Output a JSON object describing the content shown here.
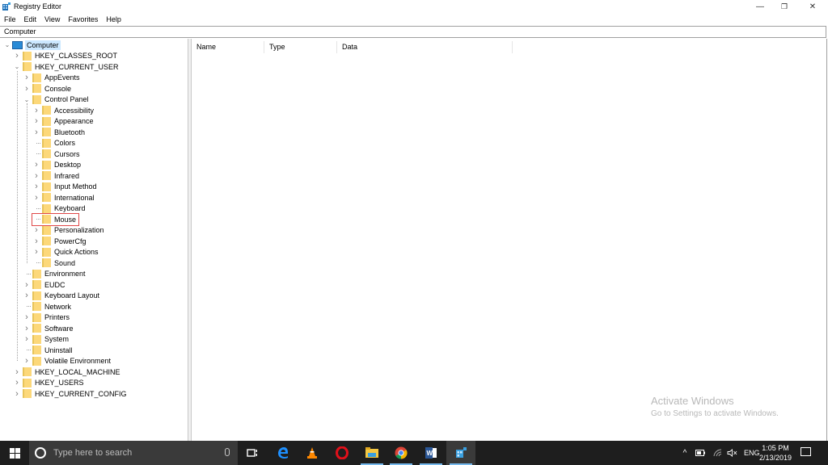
{
  "window": {
    "title": "Registry Editor",
    "controls": {
      "minimize": "—",
      "restore": "❐",
      "close": "✕"
    }
  },
  "menu": [
    "File",
    "Edit",
    "View",
    "Favorites",
    "Help"
  ],
  "address": "Computer",
  "list": {
    "columns": [
      "Name",
      "Type",
      "Data"
    ],
    "rows": []
  },
  "tree": {
    "root": "Computer",
    "nodes": [
      {
        "label": "HKEY_CLASSES_ROOT",
        "level": 1,
        "expander": "collapsed"
      },
      {
        "label": "HKEY_CURRENT_USER",
        "level": 1,
        "expander": "expanded"
      },
      {
        "label": "AppEvents",
        "level": 2,
        "expander": "collapsed"
      },
      {
        "label": "Console",
        "level": 2,
        "expander": "collapsed"
      },
      {
        "label": "Control Panel",
        "level": 2,
        "expander": "expanded"
      },
      {
        "label": "Accessibility",
        "level": 3,
        "expander": "collapsed"
      },
      {
        "label": "Appearance",
        "level": 3,
        "expander": "collapsed"
      },
      {
        "label": "Bluetooth",
        "level": 3,
        "expander": "collapsed"
      },
      {
        "label": "Colors",
        "level": 3,
        "expander": "none"
      },
      {
        "label": "Cursors",
        "level": 3,
        "expander": "none"
      },
      {
        "label": "Desktop",
        "level": 3,
        "expander": "collapsed"
      },
      {
        "label": "Infrared",
        "level": 3,
        "expander": "collapsed"
      },
      {
        "label": "Input Method",
        "level": 3,
        "expander": "collapsed"
      },
      {
        "label": "International",
        "level": 3,
        "expander": "collapsed"
      },
      {
        "label": "Keyboard",
        "level": 3,
        "expander": "none"
      },
      {
        "label": "Mouse",
        "level": 3,
        "expander": "none",
        "highlighted": true
      },
      {
        "label": "Personalization",
        "level": 3,
        "expander": "collapsed"
      },
      {
        "label": "PowerCfg",
        "level": 3,
        "expander": "collapsed"
      },
      {
        "label": "Quick Actions",
        "level": 3,
        "expander": "collapsed"
      },
      {
        "label": "Sound",
        "level": 3,
        "expander": "none"
      },
      {
        "label": "Environment",
        "level": 2,
        "expander": "none"
      },
      {
        "label": "EUDC",
        "level": 2,
        "expander": "collapsed"
      },
      {
        "label": "Keyboard Layout",
        "level": 2,
        "expander": "collapsed"
      },
      {
        "label": "Network",
        "level": 2,
        "expander": "none"
      },
      {
        "label": "Printers",
        "level": 2,
        "expander": "collapsed"
      },
      {
        "label": "Software",
        "level": 2,
        "expander": "collapsed"
      },
      {
        "label": "System",
        "level": 2,
        "expander": "collapsed"
      },
      {
        "label": "Uninstall",
        "level": 2,
        "expander": "none"
      },
      {
        "label": "Volatile Environment",
        "level": 2,
        "expander": "collapsed"
      },
      {
        "label": "HKEY_LOCAL_MACHINE",
        "level": 1,
        "expander": "collapsed"
      },
      {
        "label": "HKEY_USERS",
        "level": 1,
        "expander": "collapsed"
      },
      {
        "label": "HKEY_CURRENT_CONFIG",
        "level": 1,
        "expander": "collapsed"
      }
    ]
  },
  "watermark": {
    "title": "Activate Windows",
    "subtitle": "Go to Settings to activate Windows."
  },
  "taskbar": {
    "search_placeholder": "Type here to search",
    "apps": [
      {
        "name": "task-view",
        "icon": "task-view-icon"
      },
      {
        "name": "edge",
        "icon": "edge-icon",
        "color": "#1e90ff"
      },
      {
        "name": "vlc",
        "icon": "vlc-icon",
        "color": "#ff8800"
      },
      {
        "name": "opera",
        "icon": "opera-icon",
        "color": "#e0101a"
      },
      {
        "name": "file-explorer",
        "icon": "folder-icon",
        "color": "#f5c842"
      },
      {
        "name": "chrome",
        "icon": "chrome-icon",
        "color": "#4caf50"
      },
      {
        "name": "word",
        "icon": "word-icon",
        "color": "#2b5797"
      },
      {
        "name": "registry-editor",
        "icon": "regedit-icon",
        "color": "#3aa0e0",
        "active": true
      }
    ],
    "tray": {
      "language": "ENG",
      "time": "1:05 PM",
      "date": "2/13/2019"
    }
  },
  "colors": {
    "taskbar": "#1e1e1e",
    "selection_outline": "#e04848",
    "folder": "#fcd87a"
  }
}
